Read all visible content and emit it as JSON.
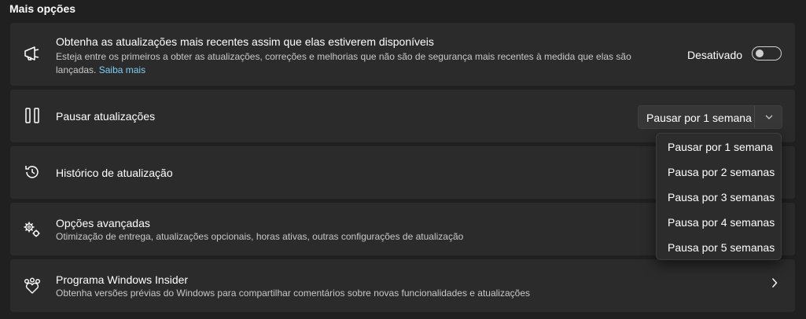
{
  "section_title": "Mais opções",
  "latest_updates": {
    "title": "Obtenha as atualizações mais recentes assim que elas estiverem disponíveis",
    "description": "Esteja entre os primeiros a obter as atualizações, correções e melhorias que não são de segurança mais recentes à medida que elas são lançadas.",
    "link": "Saiba mais",
    "toggle_label": "Desativado",
    "toggle_on": false,
    "icon": "megaphone-icon"
  },
  "pause_updates": {
    "title": "Pausar atualizações",
    "selected": "Pausar por 1 semana",
    "icon": "pause-icon"
  },
  "history": {
    "title": "Histórico de atualização",
    "icon": "history-icon"
  },
  "advanced": {
    "title": "Opções avançadas",
    "description": "Otimização de entrega, atualizações opcionais, horas ativas, outras configurações de atualização",
    "icon": "gears-icon"
  },
  "insider": {
    "title": "Programa Windows Insider",
    "description": "Obtenha versões prévias do Windows para compartilhar comentários sobre novas funcionalidades e atualizações",
    "icon": "insider-icon"
  },
  "pause_options": [
    "Pausar por 1 semana",
    "Pausa por 2 semanas",
    "Pausa por 3 semanas",
    "Pausa por 4 semanas",
    "Pausa por 5 semanas"
  ],
  "colors": {
    "background": "#202020",
    "card": "#2b2b2b",
    "link": "#7ecff7"
  }
}
